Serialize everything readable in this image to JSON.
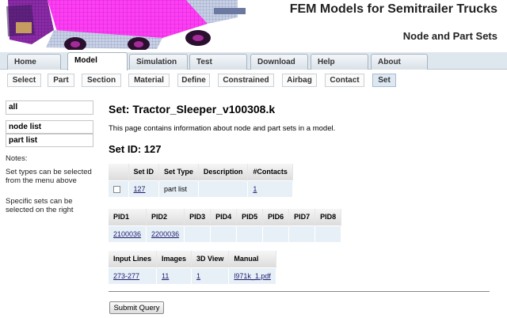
{
  "header": {
    "title": "FEM Models for Semitrailer Trucks",
    "subtitle": "Node and Part Sets",
    "colors": {
      "truck_mesh": "#ff00ff",
      "truck_cab": "#9b1fa0",
      "truck_dark": "#3a1552",
      "truck_yellow": "#d8b25a"
    }
  },
  "main_tabs": [
    "Home",
    "Model",
    "Simulation",
    "Test",
    "Download",
    "Help",
    "About"
  ],
  "active_main_tab": "Model",
  "sub_tabs": [
    "Select",
    "Part",
    "Section",
    "Material",
    "Define",
    "Constrained",
    "Airbag",
    "Contact",
    "Set"
  ],
  "active_sub_tab": "Set",
  "sidebar": {
    "filter_value": "all",
    "list_items": [
      "node list",
      "part list"
    ],
    "notes_heading": "Notes:",
    "note1": "Set types can be selected from the menu above",
    "note2": "Specific sets can be selected on the right"
  },
  "content": {
    "heading": "Set: Tractor_Sleeper_v100308.k",
    "intro": "This page contains information about node and part sets in a model.",
    "set_id_heading": "Set ID: 127"
  },
  "set_table": {
    "headers": [
      "",
      "Set ID",
      "Set Type",
      "Description",
      "#Contacts"
    ],
    "row": {
      "set_id": "127",
      "set_type": "part list",
      "description": "",
      "contacts": "1"
    }
  },
  "pid_table": {
    "headers": [
      "PID1",
      "PID2",
      "PID3",
      "PID4",
      "PID5",
      "PID6",
      "PID7",
      "PID8"
    ],
    "values": [
      "2100036",
      "2200036",
      "",
      "",
      "",
      "",
      "",
      ""
    ]
  },
  "info_table": {
    "headers": [
      "Input Lines",
      "Images",
      "3D View",
      "Manual"
    ],
    "values": [
      "273-277",
      "11",
      "1",
      "l971k_1.pdf"
    ]
  },
  "submit_label": "Submit Query"
}
